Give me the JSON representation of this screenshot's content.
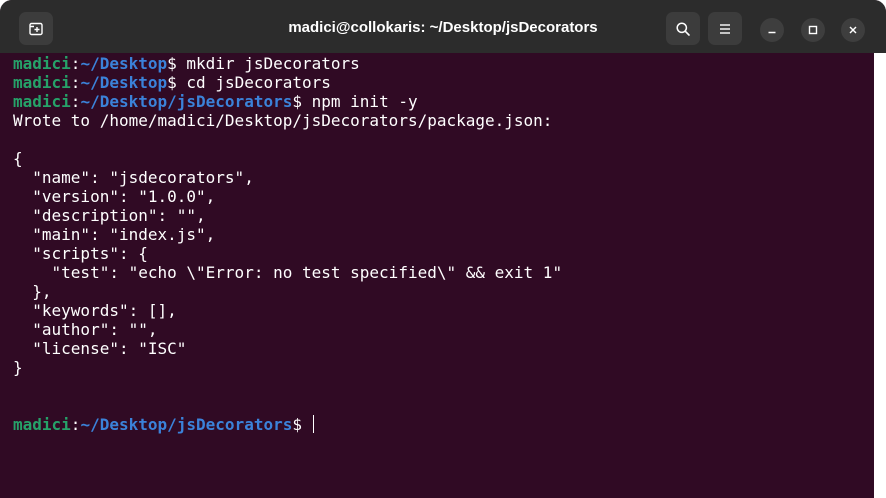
{
  "window": {
    "title": "madici@collokaris: ~/Desktop/jsDecorators",
    "icons": {
      "new_tab": "new-tab-icon",
      "search": "search-icon",
      "menu": "hamburger-menu-icon",
      "minimize": "minimize-icon",
      "maximize": "maximize-icon",
      "close": "close-icon"
    }
  },
  "colors": {
    "terminal_bg": "#300a24",
    "titlebar_bg": "#2c2c2c",
    "prompt_user": "#26a269",
    "prompt_path": "#3b82d9",
    "text": "#ffffff"
  },
  "terminal": {
    "prompts": [
      {
        "user": "madici",
        "sep": ":",
        "path": "~/Desktop",
        "dollar": "$",
        "command": " mkdir jsDecorators"
      },
      {
        "user": "madici",
        "sep": ":",
        "path": "~/Desktop",
        "dollar": "$",
        "command": " cd jsDecorators"
      },
      {
        "user": "madici",
        "sep": ":",
        "path": "~/Desktop/jsDecorators",
        "dollar": "$",
        "command": " npm init -y"
      }
    ],
    "output": [
      "Wrote to /home/madici/Desktop/jsDecorators/package.json:",
      "",
      "{",
      "  \"name\": \"jsdecorators\",",
      "  \"version\": \"1.0.0\",",
      "  \"description\": \"\",",
      "  \"main\": \"index.js\",",
      "  \"scripts\": {",
      "    \"test\": \"echo \\\"Error: no test specified\\\" && exit 1\"",
      "  },",
      "  \"keywords\": [],",
      "  \"author\": \"\",",
      "  \"license\": \"ISC\"",
      "}"
    ],
    "final_prompt": {
      "user": "madici",
      "sep": ":",
      "path": "~/Desktop/jsDecorators",
      "dollar": "$",
      "command": " "
    }
  }
}
